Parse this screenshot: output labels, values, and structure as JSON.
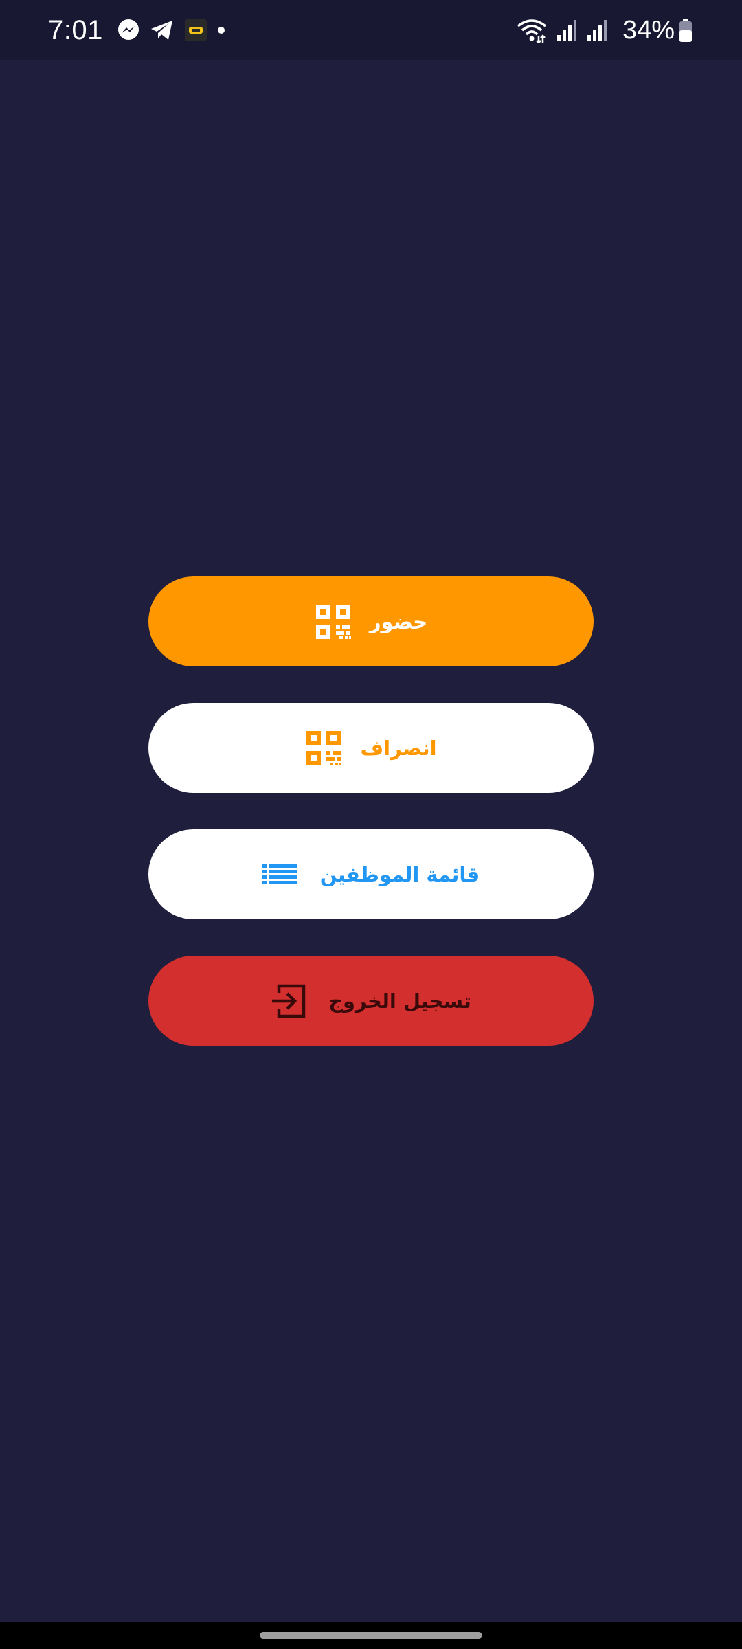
{
  "status_bar": {
    "time": "7:01",
    "battery": "34%",
    "notification_icons": [
      "messenger-icon",
      "telegram-icon",
      "app-notification-icon",
      "dot-icon"
    ],
    "system_icons": [
      "wifi-icon",
      "signal-icon",
      "signal-icon",
      "battery-icon"
    ]
  },
  "actions": [
    {
      "label": "حضور",
      "icon": "qr-code-icon",
      "background": "#ff9800",
      "text_color": "#ffffff"
    },
    {
      "label": "انصراف",
      "icon": "qr-code-icon",
      "background": "#ffffff",
      "text_color": "#ff9800"
    },
    {
      "label": "قائمة الموظفين",
      "icon": "list-icon",
      "background": "#ffffff",
      "text_color": "#2196f3"
    },
    {
      "label": "تسجيل الخروج",
      "icon": "logout-icon",
      "background": "#d32f2f",
      "text_color": "#3a0a0a"
    }
  ],
  "colors": {
    "background": "#1f1f3d",
    "status_bar": "#181832",
    "accent_orange": "#ff9800",
    "accent_blue": "#2196f3",
    "danger_red": "#d32f2f"
  }
}
